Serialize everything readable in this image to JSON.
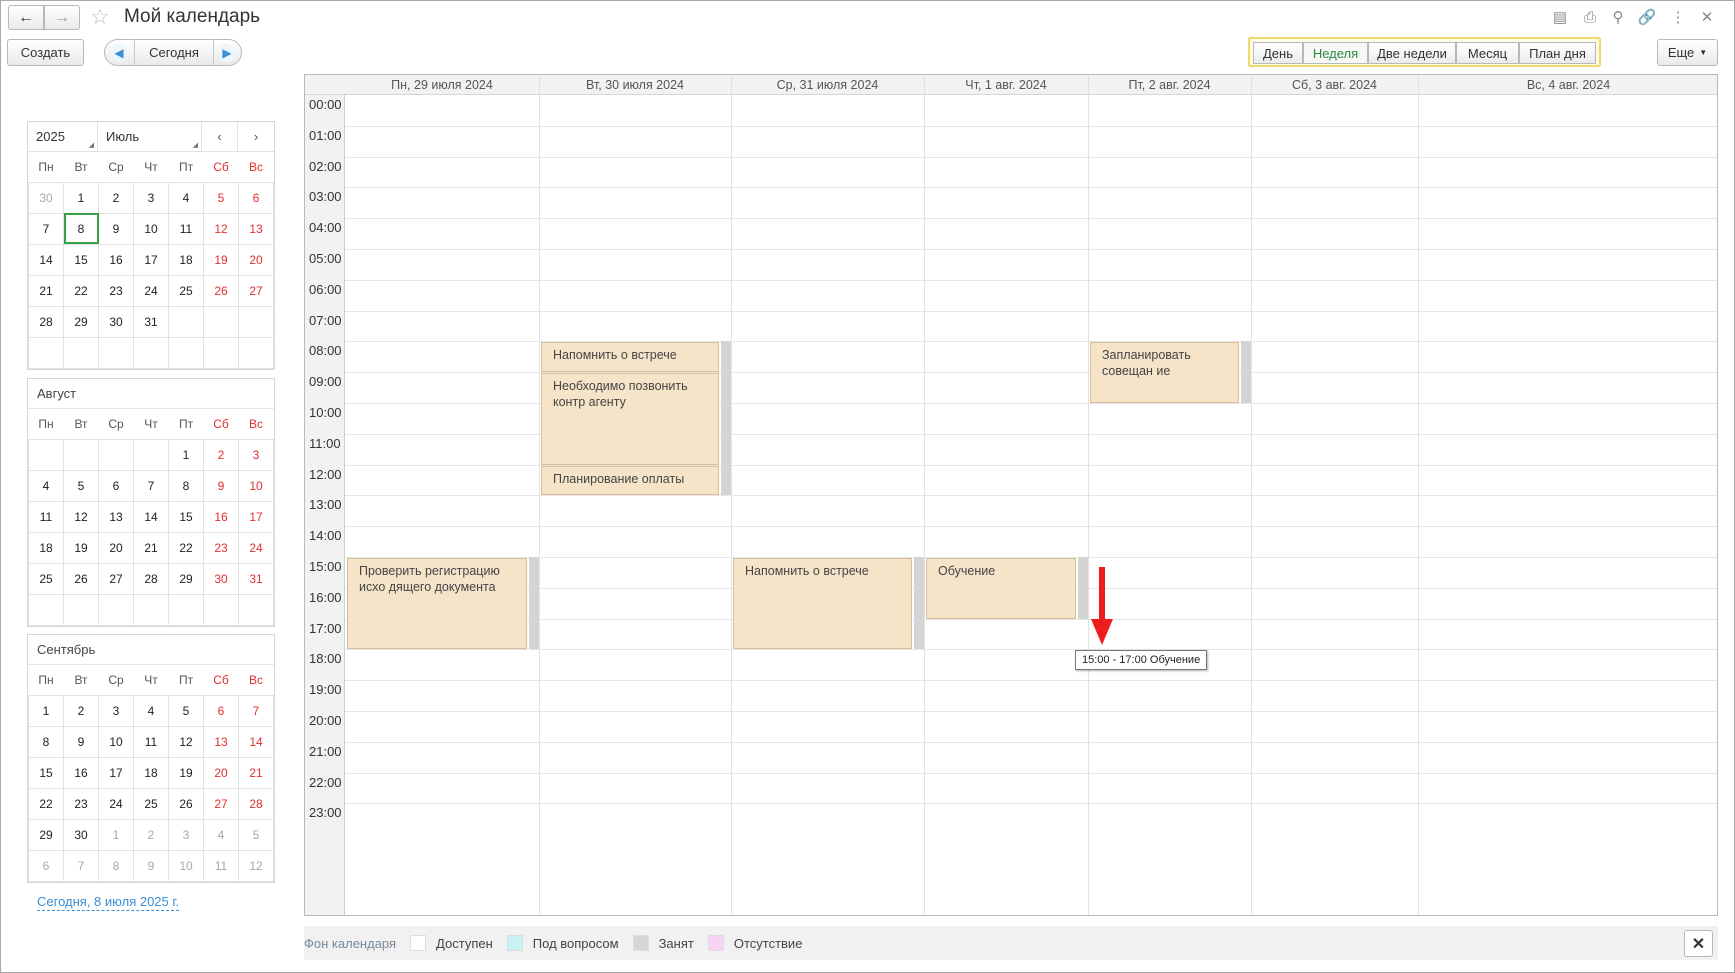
{
  "window": {
    "title": "Мой календарь"
  },
  "toolbar": {
    "create": "Создать",
    "today": "Сегодня",
    "more": "Еще",
    "views": [
      {
        "label": "День",
        "active": false
      },
      {
        "label": "Неделя",
        "active": true
      },
      {
        "label": "Две недели",
        "active": false
      },
      {
        "label": "Месяц",
        "active": false
      },
      {
        "label": "План дня",
        "active": false
      }
    ]
  },
  "mini_calendars": {
    "year": "2025",
    "month": "Июль",
    "weekdays": [
      "Пн",
      "Вт",
      "Ср",
      "Чт",
      "Пт",
      "Сб",
      "Вс"
    ],
    "months": [
      {
        "name": "",
        "rows": [
          [
            "30",
            "1",
            "2",
            "3",
            "4",
            "5",
            "6"
          ],
          [
            "7",
            "8",
            "9",
            "10",
            "11",
            "12",
            "13"
          ],
          [
            "14",
            "15",
            "16",
            "17",
            "18",
            "19",
            "20"
          ],
          [
            "21",
            "22",
            "23",
            "24",
            "25",
            "26",
            "27"
          ],
          [
            "28",
            "29",
            "30",
            "31",
            "",
            "",
            ""
          ],
          [
            "",
            "",
            "",
            "",
            "",
            "",
            ""
          ]
        ],
        "dim": [
          "0-0"
        ],
        "today": "1-1"
      },
      {
        "name": "Август",
        "rows": [
          [
            "",
            "",
            "",
            "",
            "1",
            "2",
            "3"
          ],
          [
            "4",
            "5",
            "6",
            "7",
            "8",
            "9",
            "10"
          ],
          [
            "11",
            "12",
            "13",
            "14",
            "15",
            "16",
            "17"
          ],
          [
            "18",
            "19",
            "20",
            "21",
            "22",
            "23",
            "24"
          ],
          [
            "25",
            "26",
            "27",
            "28",
            "29",
            "30",
            "31"
          ],
          [
            "",
            "",
            "",
            "",
            "",
            "",
            ""
          ]
        ],
        "dim": [],
        "today": ""
      },
      {
        "name": "Сентябрь",
        "rows": [
          [
            "1",
            "2",
            "3",
            "4",
            "5",
            "6",
            "7"
          ],
          [
            "8",
            "9",
            "10",
            "11",
            "12",
            "13",
            "14"
          ],
          [
            "15",
            "16",
            "17",
            "18",
            "19",
            "20",
            "21"
          ],
          [
            "22",
            "23",
            "24",
            "25",
            "26",
            "27",
            "28"
          ],
          [
            "29",
            "30",
            "1",
            "2",
            "3",
            "4",
            "5"
          ],
          [
            "6",
            "7",
            "8",
            "9",
            "10",
            "11",
            "12"
          ]
        ],
        "dim": [
          "4-2",
          "4-3",
          "4-4",
          "4-5",
          "4-6",
          "5-0",
          "5-1",
          "5-2",
          "5-3",
          "5-4",
          "5-5",
          "5-6"
        ],
        "today": ""
      }
    ],
    "today_link": "Сегодня, 8 июля 2025 г."
  },
  "week": {
    "days": [
      "Пн, 29 июля 2024",
      "Вт, 30 июля 2024",
      "Ср, 31 июля 2024",
      "Чт, 1 авг. 2024",
      "Пт, 2 авг. 2024",
      "Сб, 3 авг. 2024",
      "Вс, 4 авг. 2024"
    ],
    "hours": [
      "00:00",
      "01:00",
      "02:00",
      "03:00",
      "04:00",
      "05:00",
      "06:00",
      "07:00",
      "08:00",
      "09:00",
      "10:00",
      "11:00",
      "12:00",
      "13:00",
      "14:00",
      "15:00",
      "16:00",
      "17:00",
      "18:00",
      "19:00",
      "20:00",
      "21:00",
      "22:00",
      "23:00"
    ],
    "events": [
      {
        "day": 1,
        "start": 8,
        "end": 9,
        "title": "Напомнить о встрече"
      },
      {
        "day": 1,
        "start": 9,
        "end": 12,
        "title": "Необходимо позвонить контр агенту"
      },
      {
        "day": 1,
        "start": 12,
        "end": 13,
        "title": "Планирование оплаты"
      },
      {
        "day": 4,
        "start": 8,
        "end": 10,
        "title": "Запланировать совещан ие"
      },
      {
        "day": 0,
        "start": 15,
        "end": 18,
        "title": "Проверить регистрацию исхо дящего документа"
      },
      {
        "day": 2,
        "start": 15,
        "end": 18,
        "title": "Напомнить о встрече"
      },
      {
        "day": 3,
        "start": 15,
        "end": 17,
        "title": "Обучение"
      }
    ],
    "tooltip": "15:00 - 17:00 Обучение"
  },
  "legend": {
    "title": "Фон календаря",
    "items": [
      {
        "label": "Доступен",
        "color": "#ffffff"
      },
      {
        "label": "Под вопросом",
        "color": "#c8f2f4"
      },
      {
        "label": "Занят",
        "color": "#d6d6d6"
      },
      {
        "label": "Отсутствие",
        "color": "#f7d4f4"
      }
    ]
  },
  "colors": {
    "accent_green": "#2c8a3a",
    "event_bg": "#f5e4c8",
    "weekend_red": "#e03030",
    "arrow_red": "#ee1c1c"
  }
}
